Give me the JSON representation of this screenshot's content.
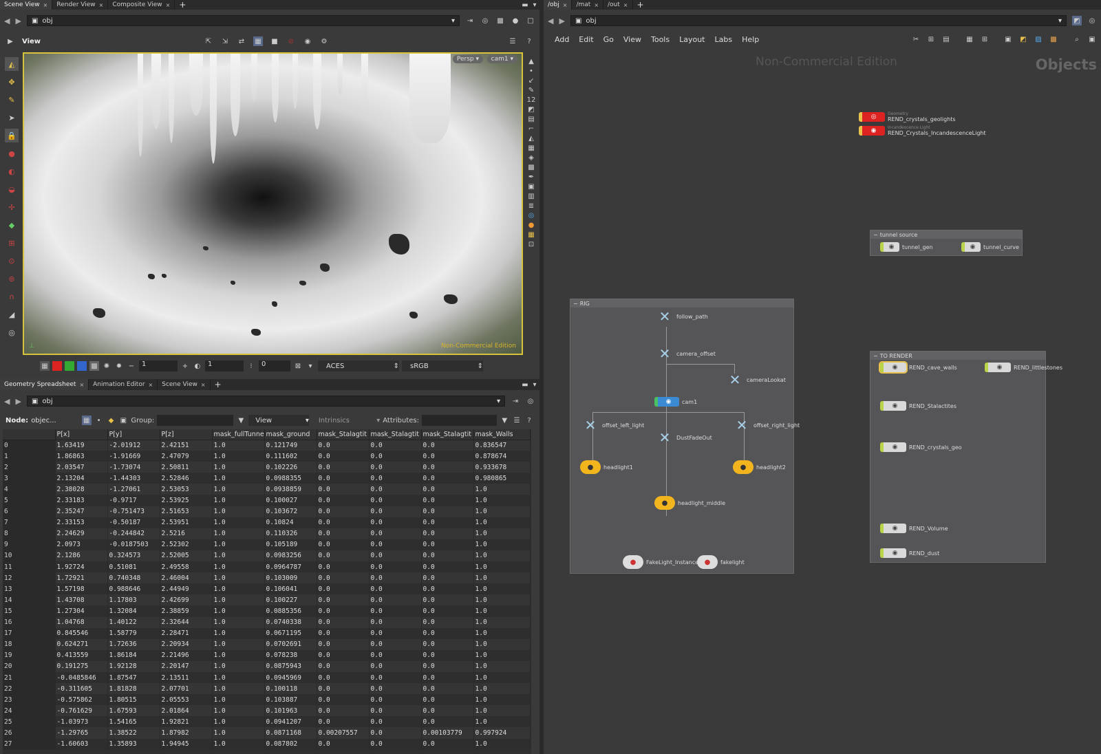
{
  "left_tabs": [
    {
      "label": "Scene View"
    },
    {
      "label": "Render View"
    },
    {
      "label": "Composite View"
    }
  ],
  "right_tabs": [
    {
      "label": "/obj"
    },
    {
      "label": "/mat"
    },
    {
      "label": "/out"
    }
  ],
  "left_path": "obj",
  "right_path": "obj",
  "spread_path": "obj",
  "viewer": {
    "title": "View",
    "persp": "Persp",
    "camera": "cam1",
    "watermark": "Non-Commercial Edition",
    "frame_a": "1",
    "frame_b": "1",
    "frame_c": "0",
    "colorspace": "ACES",
    "display": "sRGB"
  },
  "network": {
    "menu": [
      "Add",
      "Edit",
      "Go",
      "View",
      "Tools",
      "Layout",
      "Labs",
      "Help"
    ],
    "watermark": "Non-Commercial Edition",
    "context_label": "Objects",
    "top_nodes": [
      {
        "sub": "Geometry",
        "name": "REND_crystals_geolights"
      },
      {
        "sub": "Incandescence Light",
        "name": "REND_Crystals_IncandescenceLight"
      }
    ],
    "tunnel_box": {
      "title": "tunnel source",
      "nodes": [
        "tunnel_gen",
        "tunnel_curve"
      ]
    },
    "rig_box": {
      "title": "RIG",
      "nodes": {
        "follow_path": "follow_path",
        "camera_offset": "camera_offset",
        "cameraLookat": "cameraLookat",
        "cam1": "cam1",
        "offset_left_light": "offset_left_light",
        "offset_right_light": "offset_right_light",
        "DustFadeOut": "DustFadeOut",
        "headlight1": "headlight1",
        "headlight2": "headlight2",
        "headlight_middle": "headlight_middle",
        "FakeLight_Instances": "FakeLight_Instances",
        "fakelight": "fakelight"
      }
    },
    "render_box": {
      "title": "TO RENDER",
      "nodes": [
        "REND_cave_walls",
        "REND_littlestones",
        "REND_Stalactites",
        "REND_crystals_geo",
        "REND_Volume",
        "REND_dust"
      ]
    }
  },
  "bottom_tabs": [
    {
      "label": "Geometry Spreadsheet"
    },
    {
      "label": "Animation Editor"
    },
    {
      "label": "Scene View"
    }
  ],
  "spreadsheet": {
    "node_label": "Node:",
    "node_value": "objec...",
    "group_label": "Group:",
    "view_label": "View",
    "intrinsics_label": "Intrinsics",
    "attributes_label": "Attributes:",
    "columns": [
      "",
      "P[x]",
      "P[y]",
      "P[z]",
      "mask_fullTunne",
      "mask_ground",
      "mask_Stalagtit",
      "mask_Stalagtit",
      "mask_Stalagtit",
      "mask_Walls"
    ],
    "rows": [
      [
        "0",
        "1.63419",
        "-2.01912",
        "2.42151",
        "1.0",
        "0.121749",
        "0.0",
        "0.0",
        "0.0",
        "0.836547"
      ],
      [
        "1",
        "1.86863",
        "-1.91669",
        "2.47079",
        "1.0",
        "0.111602",
        "0.0",
        "0.0",
        "0.0",
        "0.878674"
      ],
      [
        "2",
        "2.03547",
        "-1.73074",
        "2.50811",
        "1.0",
        "0.102226",
        "0.0",
        "0.0",
        "0.0",
        "0.933678"
      ],
      [
        "3",
        "2.13204",
        "-1.44303",
        "2.52846",
        "1.0",
        "0.0988355",
        "0.0",
        "0.0",
        "0.0",
        "0.980865"
      ],
      [
        "4",
        "2.38028",
        "-1.27061",
        "2.53053",
        "1.0",
        "0.0938859",
        "0.0",
        "0.0",
        "0.0",
        "1.0"
      ],
      [
        "5",
        "2.33183",
        "-0.9717",
        "2.53925",
        "1.0",
        "0.100027",
        "0.0",
        "0.0",
        "0.0",
        "1.0"
      ],
      [
        "6",
        "2.35247",
        "-0.751473",
        "2.51653",
        "1.0",
        "0.103672",
        "0.0",
        "0.0",
        "0.0",
        "1.0"
      ],
      [
        "7",
        "2.33153",
        "-0.50187",
        "2.53951",
        "1.0",
        "0.10824",
        "0.0",
        "0.0",
        "0.0",
        "1.0"
      ],
      [
        "8",
        "2.24629",
        "-0.244842",
        "2.5216",
        "1.0",
        "0.110326",
        "0.0",
        "0.0",
        "0.0",
        "1.0"
      ],
      [
        "9",
        "2.0973",
        "-0.0187503",
        "2.52302",
        "1.0",
        "0.105189",
        "0.0",
        "0.0",
        "0.0",
        "1.0"
      ],
      [
        "10",
        "2.1286",
        "0.324573",
        "2.52005",
        "1.0",
        "0.0983256",
        "0.0",
        "0.0",
        "0.0",
        "1.0"
      ],
      [
        "11",
        "1.92724",
        "0.51081",
        "2.49558",
        "1.0",
        "0.0964787",
        "0.0",
        "0.0",
        "0.0",
        "1.0"
      ],
      [
        "12",
        "1.72921",
        "0.740348",
        "2.46004",
        "1.0",
        "0.103009",
        "0.0",
        "0.0",
        "0.0",
        "1.0"
      ],
      [
        "13",
        "1.57198",
        "0.988646",
        "2.44949",
        "1.0",
        "0.106041",
        "0.0",
        "0.0",
        "0.0",
        "1.0"
      ],
      [
        "14",
        "1.43708",
        "1.17803",
        "2.42699",
        "1.0",
        "0.100227",
        "0.0",
        "0.0",
        "0.0",
        "1.0"
      ],
      [
        "15",
        "1.27304",
        "1.32084",
        "2.38859",
        "1.0",
        "0.0885356",
        "0.0",
        "0.0",
        "0.0",
        "1.0"
      ],
      [
        "16",
        "1.04768",
        "1.40122",
        "2.32644",
        "1.0",
        "0.0740338",
        "0.0",
        "0.0",
        "0.0",
        "1.0"
      ],
      [
        "17",
        "0.845546",
        "1.58779",
        "2.28471",
        "1.0",
        "0.0671195",
        "0.0",
        "0.0",
        "0.0",
        "1.0"
      ],
      [
        "18",
        "0.624271",
        "1.72636",
        "2.20934",
        "1.0",
        "0.0702691",
        "0.0",
        "0.0",
        "0.0",
        "1.0"
      ],
      [
        "19",
        "0.413559",
        "1.86184",
        "2.21496",
        "1.0",
        "0.078238",
        "0.0",
        "0.0",
        "0.0",
        "1.0"
      ],
      [
        "20",
        "0.191275",
        "1.92128",
        "2.20147",
        "1.0",
        "0.0875943",
        "0.0",
        "0.0",
        "0.0",
        "1.0"
      ],
      [
        "21",
        "-0.0485846",
        "1.87547",
        "2.13511",
        "1.0",
        "0.0945969",
        "0.0",
        "0.0",
        "0.0",
        "1.0"
      ],
      [
        "22",
        "-0.311605",
        "1.81828",
        "2.07701",
        "1.0",
        "0.100118",
        "0.0",
        "0.0",
        "0.0",
        "1.0"
      ],
      [
        "23",
        "-0.575862",
        "1.80515",
        "2.05553",
        "1.0",
        "0.103887",
        "0.0",
        "0.0",
        "0.0",
        "1.0"
      ],
      [
        "24",
        "-0.761629",
        "1.67593",
        "2.01864",
        "1.0",
        "0.101963",
        "0.0",
        "0.0",
        "0.0",
        "1.0"
      ],
      [
        "25",
        "-1.03973",
        "1.54165",
        "1.92821",
        "1.0",
        "0.0941207",
        "0.0",
        "0.0",
        "0.0",
        "1.0"
      ],
      [
        "26",
        "-1.29765",
        "1.38522",
        "1.87982",
        "1.0",
        "0.0871168",
        "0.00207557",
        "0.0",
        "0.00103779",
        "0.997924"
      ],
      [
        "27",
        "-1.60603",
        "1.35893",
        "1.94945",
        "1.0",
        "0.087802",
        "0.0",
        "0.0",
        "0.0",
        "1.0"
      ]
    ]
  }
}
